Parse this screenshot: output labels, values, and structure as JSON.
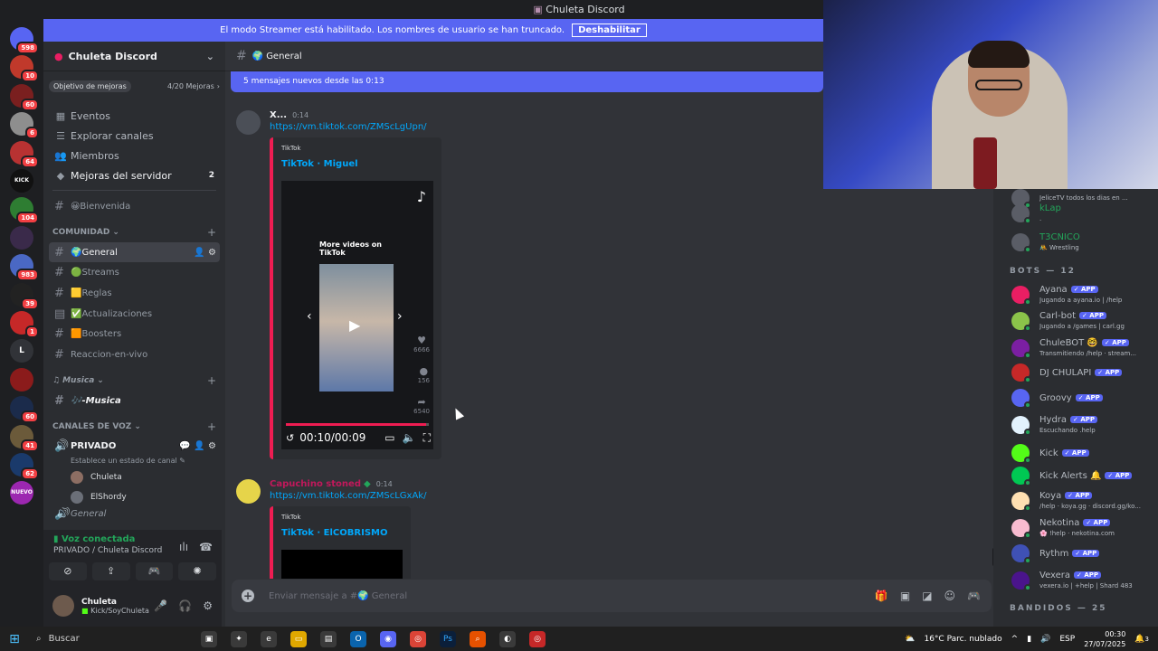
{
  "window": {
    "title": "Chuleta Discord"
  },
  "streamer": {
    "message": "El modo Streamer está habilitado. Los nombres de usuario se han truncado.",
    "button": "Deshabilitar"
  },
  "guilds": {
    "items": [
      {
        "badge": "598",
        "color": "#5865f2"
      },
      {
        "badge": "10",
        "color": "#c0392b"
      },
      {
        "badge": "60",
        "color": "#7a1f1f"
      },
      {
        "badge": "6",
        "color": "#8e8e8e"
      },
      {
        "badge": "64",
        "color": "#b83232"
      },
      {
        "badge": "",
        "label": "KICK",
        "color": "#111111"
      },
      {
        "badge": "104",
        "color": "#2e7d32"
      },
      {
        "badge": "",
        "color": "#3a2a4a"
      },
      {
        "badge": "983",
        "color": "#4a68c4"
      },
      {
        "badge": "39",
        "color": "#222222"
      },
      {
        "badge": "1",
        "color": "#c62828"
      },
      {
        "badge": "",
        "label": "L",
        "color": "#313338"
      },
      {
        "badge": "",
        "color": "#8b1b1b"
      },
      {
        "badge": "60",
        "color": "#1b2b4b"
      },
      {
        "badge": "41",
        "color": "#6b5a3a"
      },
      {
        "badge": "62",
        "color": "#1a3a6b"
      },
      {
        "badge": "",
        "label": "NUEVO",
        "color": "#9c27b0"
      }
    ]
  },
  "sidebar": {
    "server_name": "Chuleta Discord",
    "goal_label": "Objetivo de mejoras",
    "goal_progress": "4/20 Mejoras",
    "nav": [
      {
        "label": "Eventos",
        "icon": "calendar-icon"
      },
      {
        "label": "Explorar canales",
        "icon": "browse-icon"
      },
      {
        "label": "Miembros",
        "icon": "members-icon"
      },
      {
        "label": "Mejoras del servidor",
        "icon": "boost-icon",
        "count": "2"
      }
    ],
    "welcome": "😀Bienvenida",
    "cat_community": "COMUNIDAD",
    "channels": [
      {
        "label": "General",
        "emoji": "🌍",
        "active": true
      },
      {
        "label": "Streams",
        "emoji": "🟢"
      },
      {
        "label": "Reglas",
        "emoji": "🟨"
      },
      {
        "label": "Actualizaciones",
        "emoji": "✅"
      },
      {
        "label": "Boosters",
        "emoji": "🟧"
      },
      {
        "label": "Reaccion-en-vivo",
        "emoji": ""
      }
    ],
    "cat_music": "Musica",
    "music_channel": "🎶-Musica",
    "cat_voice": "CANALES DE VOZ",
    "voice_channel": "PRIVADO",
    "voice_status": "Establece un estado de canal",
    "voice_users": [
      "Chuleta",
      "ElShordy"
    ],
    "voice_next": "General"
  },
  "voice_panel": {
    "title": "Voz conectada",
    "location": "PRIVADO / Chuleta Discord"
  },
  "user": {
    "name": "Chuleta",
    "status": "Kick/SoyChuleta"
  },
  "channel": {
    "name": "General",
    "new_messages": "5 mensajes nuevos desde las 0:13",
    "composer_placeholder": "Enviar mensaje a #🌍 General"
  },
  "messages": [
    {
      "author": "X...",
      "time": "0:14",
      "link": "https://vm.tiktok.com/ZMScLgUpn/",
      "provider": "TikTok",
      "embed_title": "TikTok · Miguel",
      "video": {
        "overlay": "More videos on TikTok",
        "likes": "6666",
        "comments": "156",
        "shares": "6540",
        "time": "00:10/00:09",
        "progress": 0.98
      }
    },
    {
      "author": "Capuchino stoned",
      "time": "0:14",
      "link": "https://vm.tiktok.com/ZMScLGxAk/",
      "provider": "TikTok",
      "embed_title": "TikTok · ElCOBRISMO"
    }
  ],
  "members": {
    "top": [
      {
        "name": "",
        "sub": "JeliceTV todos los dias en ...",
        "color": "#dbdee1"
      },
      {
        "name": "kLap",
        "sub": ".",
        "color": "#23a55a"
      },
      {
        "name": "T3CNICO",
        "sub": "🤼 Wrestling",
        "color": "#23a55a"
      }
    ],
    "bots_header": "BOTS — 12",
    "bots": [
      {
        "name": "Ayana",
        "sub": "Jugando a ayana.io | /help",
        "avatar": "#e91e63"
      },
      {
        "name": "Carl-bot",
        "sub": "Jugando a /games | carl.gg",
        "avatar": "#8bc34a"
      },
      {
        "name": "ChuleBOT 🤓",
        "sub": "Transmitiendo /help · stream...",
        "avatar": "#7b1fa2"
      },
      {
        "name": "DJ CHULAPI",
        "sub": "",
        "avatar": "#c62828"
      },
      {
        "name": "Groovy",
        "sub": "",
        "avatar": "#5865f2"
      },
      {
        "name": "Hydra",
        "sub": "Escuchando .help",
        "avatar": "#e3f2fd"
      },
      {
        "name": "Kick",
        "sub": "",
        "avatar": "#53fc18"
      },
      {
        "name": "Kick Alerts 🔔",
        "sub": "",
        "avatar": "#00c853"
      },
      {
        "name": "Koya",
        "sub": "/help · koya.gg · discord.gg/ko...",
        "avatar": "#ffe0b2"
      },
      {
        "name": "Nekotina",
        "sub": "🌸 !help · nekotina.com",
        "avatar": "#f8bbd0"
      },
      {
        "name": "Rythm",
        "sub": "",
        "avatar": "#3f51b5"
      },
      {
        "name": "Vexera",
        "sub": "vexera.io | +help | Shard 483",
        "avatar": "#4a148c"
      }
    ],
    "bandidos_header": "BANDIDOS — 25",
    "app_badge": "✓ APP"
  },
  "taskbar": {
    "search": "Buscar",
    "weather": "16°C  Parc. nublado",
    "lang": "ESP",
    "time": "00:30",
    "date": "27/07/2025",
    "notif": "3"
  }
}
